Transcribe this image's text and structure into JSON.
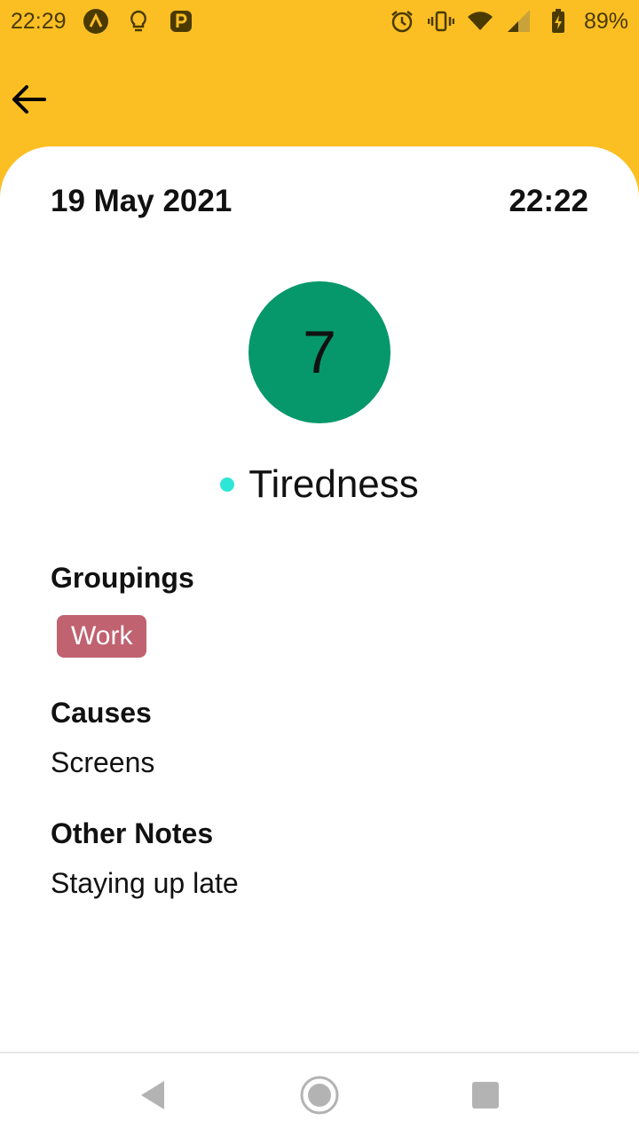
{
  "status_bar": {
    "time": "22:29",
    "battery": "89%",
    "icons_left": [
      "app-a-icon",
      "lightbulb-icon",
      "parking-icon"
    ],
    "icons_right": [
      "alarm-icon",
      "vibrate-icon",
      "wifi-icon",
      "signal-icon",
      "battery-charging-icon"
    ]
  },
  "entry": {
    "date": "19 May 2021",
    "time": "22:22",
    "score": "7",
    "symptom": "Tiredness",
    "symptom_color": "#2EE6D6",
    "score_color": "#06986A"
  },
  "groupings": {
    "title": "Groupings",
    "tags": [
      "Work"
    ],
    "tag_color": "#C06270"
  },
  "causes": {
    "title": "Causes",
    "value": "Screens"
  },
  "notes": {
    "title": "Other Notes",
    "value": "Staying up late"
  },
  "colors": {
    "header": "#FBBF24"
  }
}
